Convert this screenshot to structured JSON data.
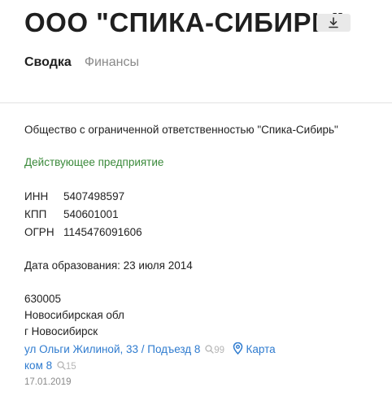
{
  "company": {
    "title": "ООО \"СПИКА-СИБИРЬ\""
  },
  "tabs": [
    {
      "label": "Сводка",
      "active": true
    },
    {
      "label": "Финансы",
      "active": false
    }
  ],
  "summary": {
    "full_name": "Общество с ограниченной ответственностью \"Спика-Сибирь\"",
    "status": "Действующее предприятие",
    "registry": [
      {
        "label": "ИНН",
        "value": "5407498597"
      },
      {
        "label": "КПП",
        "value": "540601001"
      },
      {
        "label": "ОГРН",
        "value": "1145476091606"
      }
    ],
    "founded": "Дата образования: 23 июля 2014",
    "address": {
      "postcode": "630005",
      "region": "Новосибирская обл",
      "city": "г Новосибирск",
      "street_link": "ул Ольги Жилиной, 33 / Подъезд 8",
      "street_count": "99",
      "map_link": "Карта",
      "office_link": "ком 8",
      "office_count": "15",
      "date": "17.01.2019"
    }
  },
  "colors": {
    "status_green": "#3b8a3b",
    "link_blue": "#2e7bcf",
    "muted_gray": "#8a8a8a"
  },
  "icons": {
    "download": "download-icon",
    "search": "search-icon",
    "map_pin": "map-pin-icon"
  }
}
